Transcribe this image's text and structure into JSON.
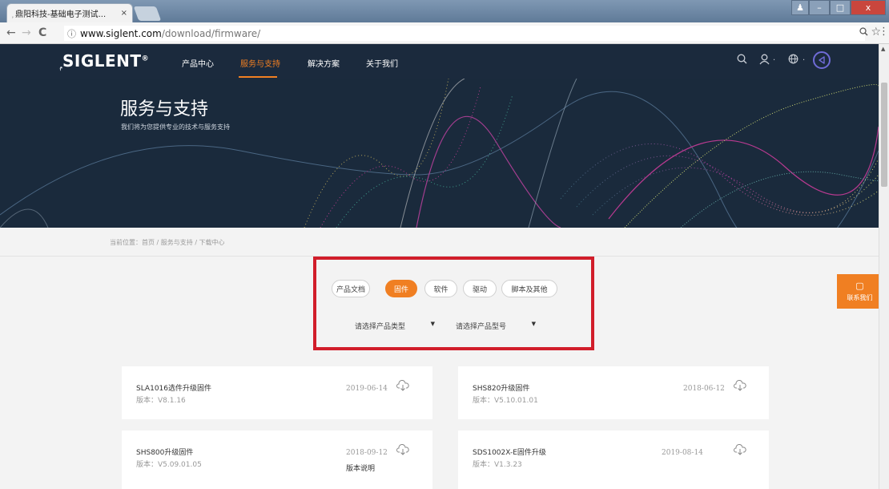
{
  "browser": {
    "tab_title": "鼎阳科技-基础电子测试...",
    "tab_close": "×",
    "url_host": "www.siglent.com",
    "url_path": "/download/firmware/",
    "back": "←",
    "forward": "→",
    "reload": "C",
    "info": "ⓘ",
    "zoom": "🔍",
    "star": "☆",
    "menu": "⋮",
    "win_min": "–",
    "win_max": "□",
    "win_close": "x"
  },
  "site": {
    "logo": "SIGLENT",
    "logo_reg": "®",
    "nav": [
      "产品中心",
      "服务与支持",
      "解决方案",
      "关于我们"
    ],
    "active_nav": 1,
    "icons": {
      "search": "⌕",
      "user": "♙",
      "user_caret": "·",
      "globe": "⊕",
      "globe_caret": "·",
      "share": "⊲"
    }
  },
  "banner": {
    "title": "服务与支持",
    "subtitle": "我们将为您提供专业的技术与服务支持"
  },
  "breadcrumb": "当前位置：首页 / 服务与支持 / 下载中心",
  "filters": {
    "tabs": [
      "产品文档",
      "固件",
      "软件",
      "驱动",
      "脚本及其他"
    ],
    "active_tab": 1,
    "select_type": "请选择产品类型",
    "select_model": "请选择产品型号",
    "arrow": "▼"
  },
  "contact": {
    "label": "联系我们",
    "icon": "▢"
  },
  "downloads": [
    {
      "name": "SLA1016选件升级固件",
      "version": "版本：V8.1.16",
      "date": "2019-06-14",
      "notes": ""
    },
    {
      "name": "SHS820升级固件",
      "version": "版本：V5.10.01.01",
      "date": "2018-06-12",
      "notes": ""
    },
    {
      "name": "SHS800升级固件",
      "version": "版本：V5.09.01.05",
      "date": "2018-09-12",
      "notes": "版本说明"
    },
    {
      "name": "SDS1002X-E固件升级",
      "version": "版本：V1.3.23",
      "date": "2019-08-14",
      "notes": ""
    }
  ],
  "download_icon": "⇩",
  "colors": {
    "accent": "#f07f22",
    "nav_bg": "#1b2a3d",
    "highlight_box": "#d11d2a"
  }
}
